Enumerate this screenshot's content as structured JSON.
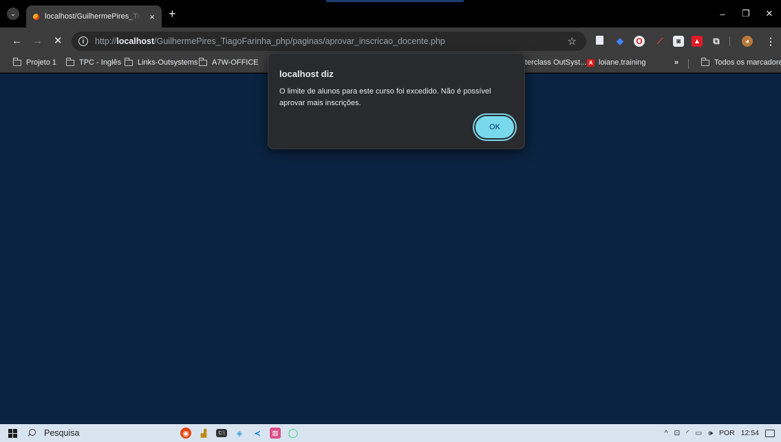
{
  "browser": {
    "tab": {
      "title": "localhost/GuilhermePires_Tiago",
      "close_glyph": "×"
    },
    "new_tab_glyph": "+",
    "window_controls": {
      "minimize": "–",
      "restore": "❐",
      "close": "✕"
    },
    "nav": {
      "back": "←",
      "forward": "→",
      "stop": "✕"
    },
    "omnibox": {
      "scheme": "http://",
      "host": "localhost",
      "path": "/GuilhermePires_TiagoFarinha_php/paginas/aprovar_inscricao_docente.php"
    },
    "bookmarks": [
      {
        "label": "Projeto 1",
        "icon": "folder-icon"
      },
      {
        "label": "TPC - Inglês",
        "icon": "folder-icon"
      },
      {
        "label": "Links-Outsystems",
        "icon": "folder-icon"
      },
      {
        "label": "A7W-OFFICE",
        "icon": "folder-icon"
      },
      {
        "label": "terclass OutSyst...",
        "icon": "page-icon"
      },
      {
        "label": "loiane.training",
        "icon": "angular-icon"
      }
    ],
    "bookmarks_overflow": "»",
    "all_bookmarks": "Todos os marcadores"
  },
  "dialog": {
    "title": "localhost diz",
    "message": "O limite de alunos para este curso foi excedido. Não é possível aprovar mais inscrições.",
    "ok_label": "OK"
  },
  "taskbar": {
    "search_placeholder": "Pesquisa",
    "language": "POR",
    "time": "12:54"
  },
  "colors": {
    "page_background": "#0a2342",
    "dialog_background": "#292a2d",
    "ok_button": "#78d9ec",
    "chrome_frame": "#3c3c3c"
  }
}
